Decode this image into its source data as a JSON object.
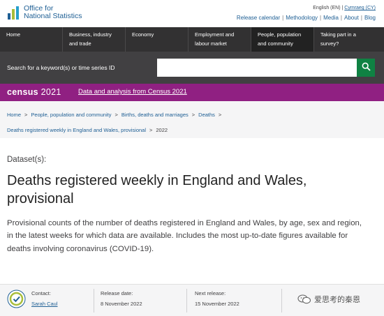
{
  "header": {
    "logo_line1": "Office for",
    "logo_line2": "National Statistics",
    "lang_current": "English (EN)",
    "lang_sep": " | ",
    "lang_other": "Cymraeg (CY)",
    "links": [
      "Release calendar",
      "Methodology",
      "Media",
      "About",
      "Blog"
    ]
  },
  "nav": {
    "items": [
      {
        "label": "Home"
      },
      {
        "label": "Business, industry and trade"
      },
      {
        "label": "Economy"
      },
      {
        "label": "Employment and labour market"
      },
      {
        "label": "People, population and community"
      },
      {
        "label": "Taking part in a survey?"
      }
    ],
    "active_index": 4
  },
  "search": {
    "label": "Search for a keyword(s) or time series ID",
    "value": "",
    "placeholder": ""
  },
  "census": {
    "logo_word": "census",
    "logo_year": "2021",
    "link_text": "Data and analysis from Census 2021"
  },
  "breadcrumb": {
    "line1": [
      "Home",
      "People, population and community",
      "Births, deaths and marriages",
      "Deaths"
    ],
    "line2_link": "Deaths registered weekly in England and Wales, provisional",
    "current": "2022"
  },
  "main": {
    "dataset_label": "Dataset(s):",
    "title": "Deaths registered weekly in England and Wales, provisional",
    "description": "Provisional counts of the number of deaths registered in England and Wales, by age, sex and region, in the latest weeks for which data are available. Includes the most up-to-date figures available for deaths involving coronavirus (COVID-19)."
  },
  "meta": {
    "contact_label": "Contact:",
    "contact_value": "Sarah Caul",
    "release_label": "Release date:",
    "release_value": "8 November 2022",
    "next_label": "Next release:",
    "next_value": "15 November 2022",
    "watermark": "爱思考的秦恩"
  },
  "colors": {
    "nav_bg": "#323132",
    "search_bg": "#414042",
    "search_button": "#0f8243",
    "census_bg": "#902082",
    "link": "#206095"
  },
  "icons": [
    "ons-logo-icon",
    "search-icon",
    "national-statistics-badge-icon",
    "wechat-icon"
  ]
}
